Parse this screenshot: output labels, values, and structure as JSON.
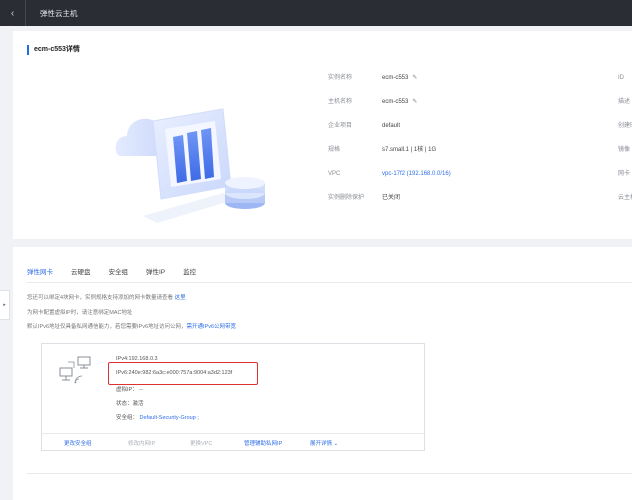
{
  "topbar": {
    "back_icon": "‹",
    "title": "弹性云主机"
  },
  "detail": {
    "title": "ecm-c553详情",
    "rows": [
      {
        "label": "实例名称",
        "value": "ecm-c553",
        "editable": true,
        "link": false
      },
      {
        "label": "主机名称",
        "value": "ecm-c553",
        "editable": true,
        "link": false
      },
      {
        "label": "企业项目",
        "value": "default",
        "editable": false,
        "link": false
      },
      {
        "label": "规格",
        "value": "s7.small.1 | 1核 | 1G",
        "editable": false,
        "link": false
      },
      {
        "label": "VPC",
        "value": "vpc-17f2 (192.168.0.0/16)",
        "editable": false,
        "link": true
      },
      {
        "label": "实例删除保护",
        "value": "已关闭",
        "editable": false,
        "link": false
      }
    ],
    "right_labels": [
      "ID",
      "描述",
      "创建时",
      "镜像",
      "网卡",
      "云主机"
    ]
  },
  "tabs": [
    "弹性网卡",
    "云硬盘",
    "安全组",
    "弹性IP",
    "监控"
  ],
  "notes": {
    "line1": "您还可以绑定4块网卡，实例规格支持添加的网卡数量请查看",
    "line1_link": "这里",
    "line2": "为网卡配置虚拟IP时，请注意绑定MAC地址",
    "line3": "默认IPv6地址仅具备私网通信能力，若您需要IPv6地址访问公网，",
    "line3_link": "需开通IPv6公网带宽"
  },
  "nic": {
    "ipv4": "IPv4:192.168.0.3",
    "ipv6": "IPv6:240e:982:6a3c:e000:757a:9004:a3d2:123f",
    "vip_label": "虚拟IP：",
    "vip_value": "--",
    "status_label": "状态：",
    "status_value": "激活",
    "sg_label": "安全组：",
    "sg_value": "Default-Security-Group ;",
    "actions": [
      {
        "label": "更改安全组",
        "enabled": true
      },
      {
        "label": "修改内网IP",
        "enabled": false
      },
      {
        "label": "更换VPC",
        "enabled": false
      },
      {
        "label": "管理辅助私网IP",
        "enabled": true
      },
      {
        "label": "展开详情 ⌄",
        "enabled": true
      }
    ]
  },
  "colors": {
    "accent": "#2f6ee8",
    "highlight": "#e03131",
    "topbar": "#2a2d33"
  }
}
